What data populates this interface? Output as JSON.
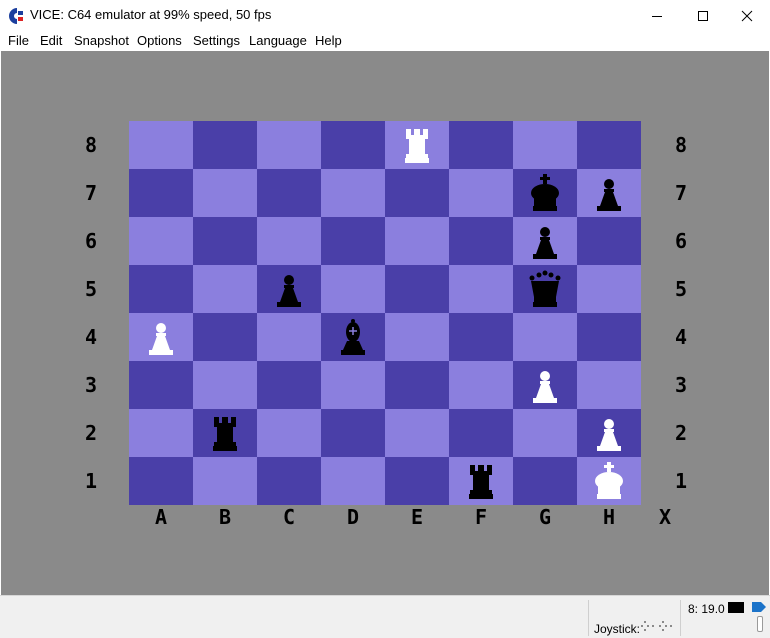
{
  "window": {
    "title": "VICE: C64 emulator at 99% speed, 50 fps"
  },
  "menu": {
    "items": [
      "File",
      "Edit",
      "Snapshot",
      "Options",
      "Settings",
      "Language",
      "Help"
    ]
  },
  "board": {
    "rank_labels": [
      "8",
      "7",
      "6",
      "5",
      "4",
      "3",
      "2",
      "1"
    ],
    "file_labels": [
      "A",
      "B",
      "C",
      "D",
      "E",
      "F",
      "G",
      "H"
    ],
    "corner_symbol": "X",
    "light_square_color": "#8b7fde",
    "dark_square_color": "#4a3fa8",
    "pieces": [
      {
        "square": "E8",
        "piece": "rook",
        "color": "white"
      },
      {
        "square": "G7",
        "piece": "king",
        "color": "black"
      },
      {
        "square": "H7",
        "piece": "pawn",
        "color": "black"
      },
      {
        "square": "G6",
        "piece": "pawn",
        "color": "black"
      },
      {
        "square": "C5",
        "piece": "pawn",
        "color": "black"
      },
      {
        "square": "G5",
        "piece": "queen",
        "color": "black"
      },
      {
        "square": "A4",
        "piece": "pawn",
        "color": "white"
      },
      {
        "square": "D4",
        "piece": "bishop",
        "color": "black"
      },
      {
        "square": "G3",
        "piece": "pawn",
        "color": "white"
      },
      {
        "square": "B2",
        "piece": "rook",
        "color": "black"
      },
      {
        "square": "H2",
        "piece": "pawn",
        "color": "white"
      },
      {
        "square": "F1",
        "piece": "rook",
        "color": "black"
      },
      {
        "square": "H1",
        "piece": "king",
        "color": "white"
      }
    ]
  },
  "statusbar": {
    "drive": "8: 19.0",
    "joystick_label": "Joystick:"
  }
}
